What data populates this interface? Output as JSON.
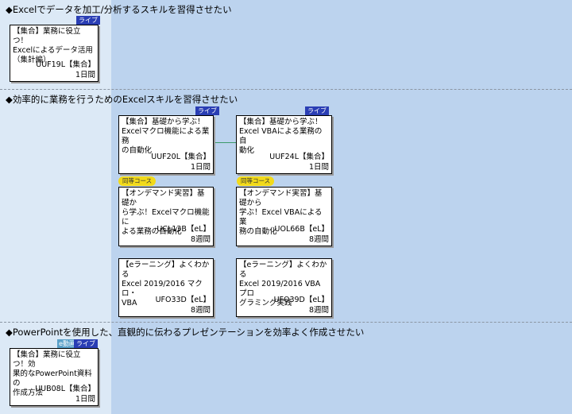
{
  "sections": [
    {
      "title": "◆Excelでデータを加工/分析するスキルを習得させたい"
    },
    {
      "title": "◆効率的に業務を行うためのExcelスキルを習得させたい"
    },
    {
      "title": "◆PowerPointを使用した、直観的に伝わるプレゼンテーションを効率よく作成させたい"
    }
  ],
  "badges": {
    "live": "ライブ",
    "edoga": "e動画",
    "equiv": "同等コース"
  },
  "cards": {
    "uuf19l": {
      "title": "【集合】業務に役立つ！\nExcelによるデータ活用\n（集計編）",
      "code": "UUF19L【集合】",
      "duration": "1日間"
    },
    "uuf20l": {
      "title": "【集合】基礎から学ぶ！\nExcelマクロ機能による業務\nの自動化",
      "code": "UUF20L【集合】",
      "duration": "1日間"
    },
    "uuf24l": {
      "title": "【集合】基礎から学ぶ！\nExcel VBAによる業務の自\n動化",
      "code": "UUF24L【集合】",
      "duration": "1日間"
    },
    "ucl13b": {
      "title": "【オンデマンド実習】基礎か\nら学ぶ！Excelマクロ機能に\nよる業務の自動化",
      "code": "UCL13B【eL】",
      "duration": "8週間"
    },
    "uol66b": {
      "title": "【オンデマンド実習】基礎から\n学ぶ！Excel VBAによる業\n務の自動化",
      "code": "UOL66B【eL】",
      "duration": "8週間"
    },
    "ufo33d": {
      "title": "【eラーニング】よくわかる\nExcel 2019/2016 マクロ・\nVBA",
      "code": "UFO33D【eL】",
      "duration": "8週間"
    },
    "ufo39d": {
      "title": "【eラーニング】よくわかる\nExcel 2019/2016 VBA プロ\nグラミング実践",
      "code": "UFO39D【eL】",
      "duration": "8週間"
    },
    "uub08l": {
      "title": "【集合】業務に役立つ！効\n果的なPowerPoint資料の\n作成方法",
      "code": "UUB08L【集合】",
      "duration": "1日間"
    }
  }
}
